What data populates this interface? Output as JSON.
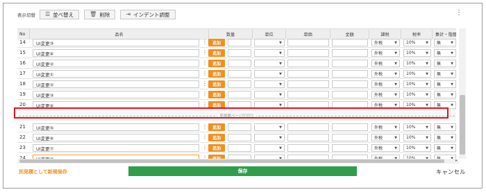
{
  "toolbar": {
    "view_toggle_label": "表示切替",
    "sort_label": "並べ替え",
    "delete_label": "削除",
    "indent_label": "インデント調整",
    "more_icon": "kebab-icon"
  },
  "table": {
    "headers": {
      "no": "No",
      "name": "品名",
      "qty": "数量",
      "unit": "単位",
      "price": "単価",
      "amount": "金額",
      "tax_type": "課税",
      "tax_rate": "税率",
      "subtotal": "集計・階層"
    },
    "add_label": "追加",
    "pagebreak_label": "見積書ページ区切り",
    "rows": [
      {
        "no": "14",
        "name": "UI変更③",
        "tax": "外税",
        "rate": "10%",
        "sub": "無"
      },
      {
        "no": "15",
        "name": "UI変更④",
        "tax": "外税",
        "rate": "10%",
        "sub": "無"
      },
      {
        "no": "16",
        "name": "UI変更②",
        "tax": "外税",
        "rate": "10%",
        "sub": "無"
      },
      {
        "no": "17",
        "name": "UI変更①",
        "tax": "外税",
        "rate": "10%",
        "sub": "無"
      },
      {
        "no": "18",
        "name": "UI変更②",
        "tax": "外税",
        "rate": "10%",
        "sub": "無"
      },
      {
        "no": "19",
        "name": "UI変更③",
        "tax": "外税",
        "rate": "10%",
        "sub": "無"
      },
      {
        "no": "20",
        "name": "UI変更④",
        "tax": "外税",
        "rate": "10%",
        "sub": "無"
      },
      {
        "no": "21",
        "name": "UI変更⑤",
        "tax": "外税",
        "rate": "10%",
        "sub": "無"
      },
      {
        "no": "22",
        "name": "UI変更⑥",
        "tax": "外税",
        "rate": "10%",
        "sub": "無"
      },
      {
        "no": "23",
        "name": "UI変更⑦",
        "tax": "外税",
        "rate": "10%",
        "sub": "無"
      },
      {
        "no": "24",
        "name": "UI変更⑧",
        "tax": "外税",
        "rate": "10%",
        "sub": "無"
      }
    ]
  },
  "footer": {
    "save_as_new_label": "別見積として新規保存",
    "save_label": "保存",
    "cancel_label": "キャンセル"
  },
  "colors": {
    "accent_orange": "#f0901e",
    "save_green": "#2e9e4a",
    "highlight_red": "#e0121f"
  }
}
